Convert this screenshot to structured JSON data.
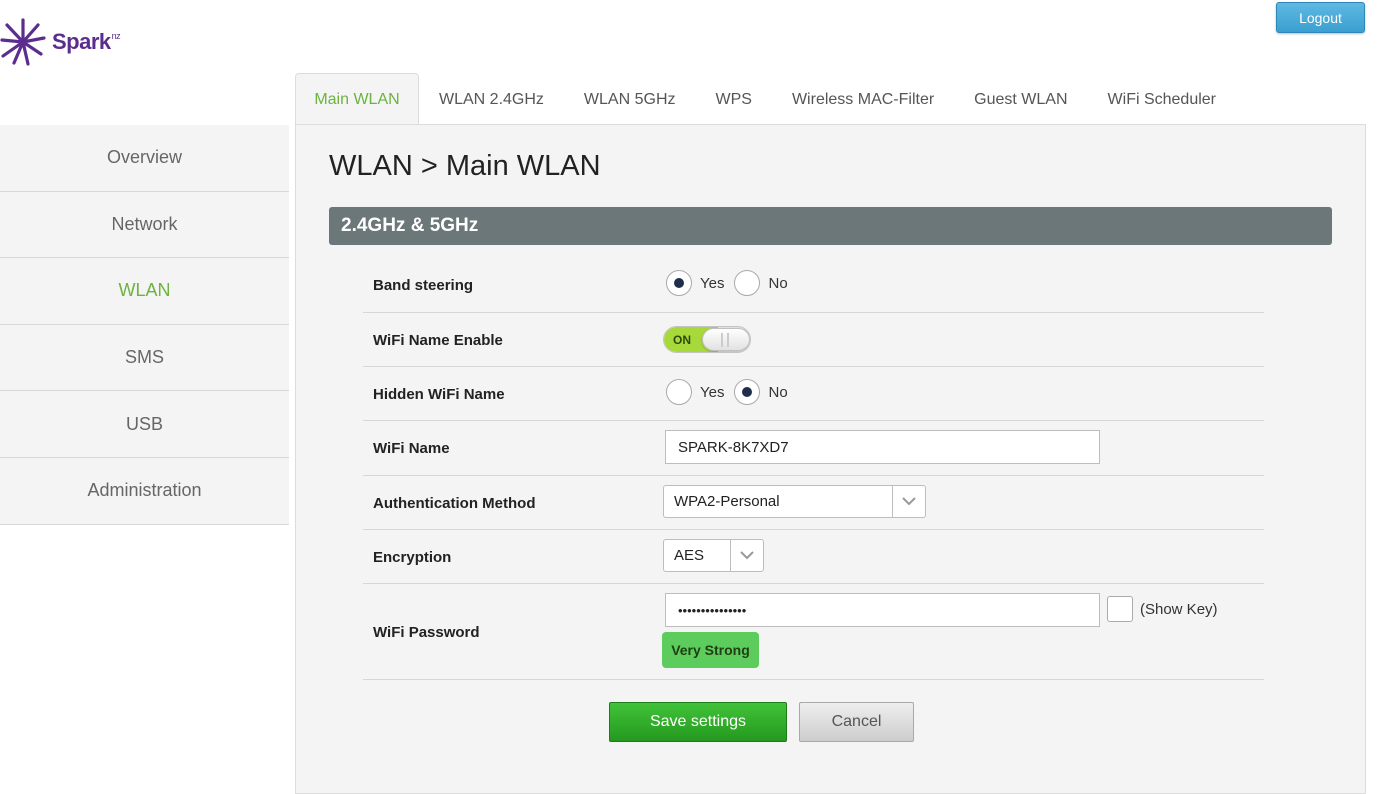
{
  "brand": {
    "logo_text": "Spark",
    "logo_suffix": "nz",
    "color": "#5b2d8e"
  },
  "header": {
    "logout_label": "Logout"
  },
  "tabs": [
    {
      "label": "Main WLAN",
      "active": true
    },
    {
      "label": "WLAN 2.4GHz",
      "active": false
    },
    {
      "label": "WLAN 5GHz",
      "active": false
    },
    {
      "label": "WPS",
      "active": false
    },
    {
      "label": "Wireless MAC-Filter",
      "active": false
    },
    {
      "label": "Guest WLAN",
      "active": false
    },
    {
      "label": "WiFi Scheduler",
      "active": false
    }
  ],
  "sidebar": {
    "items": [
      {
        "label": "Overview",
        "active": false
      },
      {
        "label": "Network",
        "active": false
      },
      {
        "label": "WLAN",
        "active": true
      },
      {
        "label": "SMS",
        "active": false
      },
      {
        "label": "USB",
        "active": false
      },
      {
        "label": "Administration",
        "active": false
      }
    ]
  },
  "main": {
    "title": "WLAN > Main WLAN",
    "section_title": "2.4GHz & 5GHz"
  },
  "form": {
    "band_steering": {
      "label": "Band steering",
      "yes": "Yes",
      "no": "No",
      "selected": "Yes"
    },
    "wifi_name_enable": {
      "label": "WiFi Name Enable",
      "toggle_text": "ON",
      "state": "on"
    },
    "hidden_wifi_name": {
      "label": "Hidden WiFi Name",
      "yes": "Yes",
      "no": "No",
      "selected": "No"
    },
    "wifi_name": {
      "label": "WiFi Name",
      "value": "SPARK-8K7XD7"
    },
    "auth_method": {
      "label": "Authentication Method",
      "value": "WPA2-Personal"
    },
    "encryption": {
      "label": "Encryption",
      "value": "AES"
    },
    "wifi_password": {
      "label": "WiFi Password",
      "masked_value": "•••••••••••••••",
      "show_key_label": "(Show Key)",
      "strength": "Very Strong"
    }
  },
  "actions": {
    "save_label": "Save settings",
    "cancel_label": "Cancel"
  },
  "colors": {
    "accent_green": "#6cb33f",
    "section_bar": "#6b7778",
    "save_button": "#2fae28",
    "logout_button": "#4aaad9",
    "strength_badge": "#5ccd5c"
  }
}
